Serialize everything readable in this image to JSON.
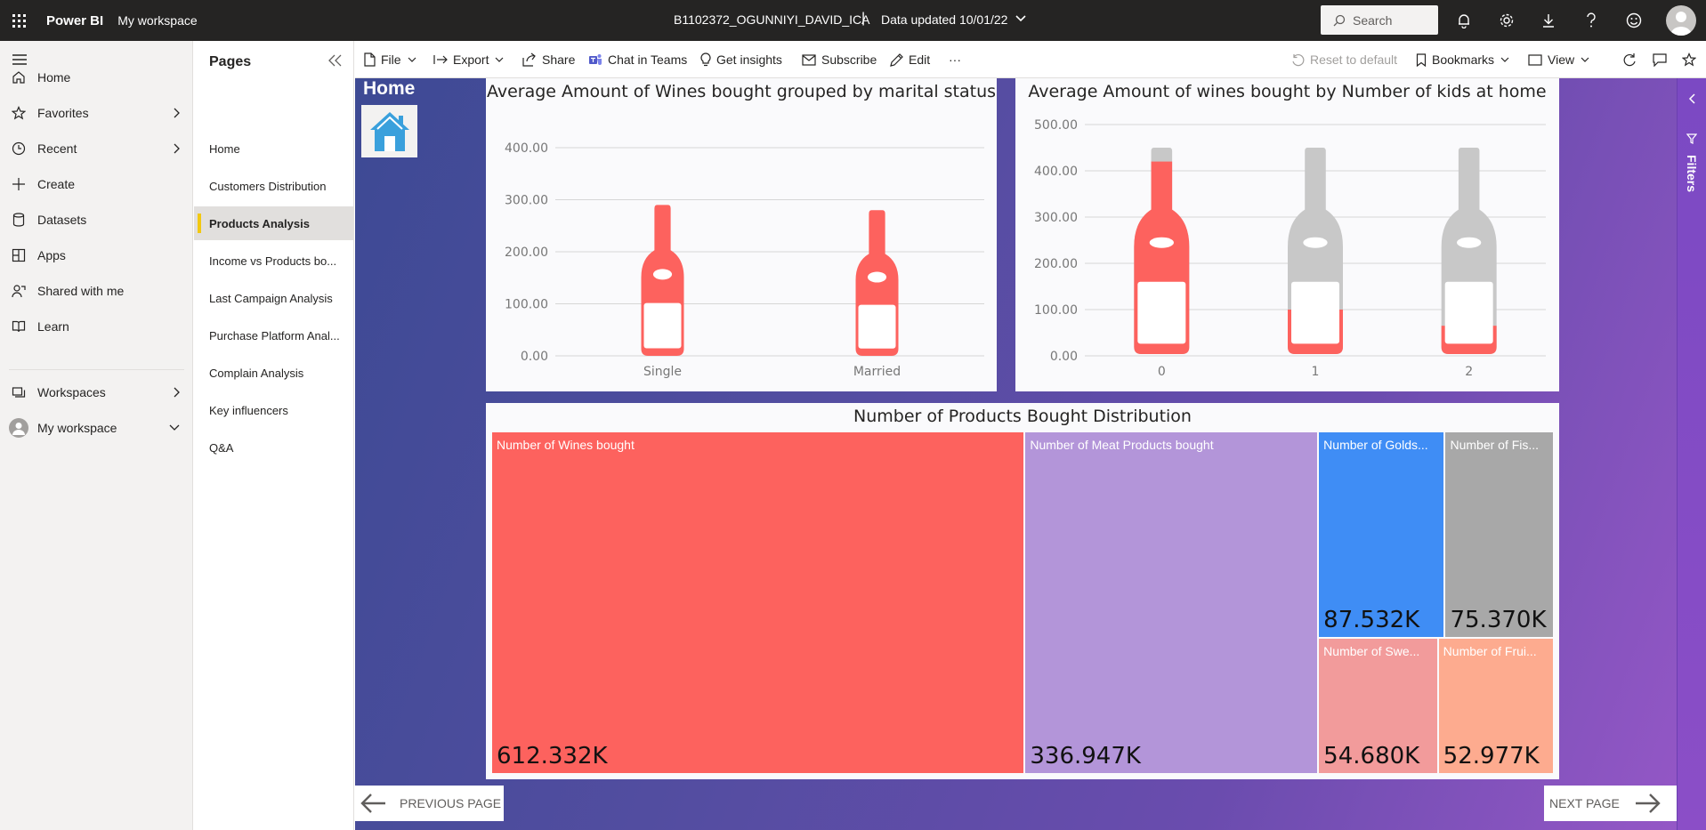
{
  "topbar": {
    "brand": "Power BI",
    "workspace": "My workspace",
    "report_title": "B1102372_OGUNNIYI_DAVID_ICA",
    "separator": "|",
    "data_updated": "Data updated 10/01/22",
    "search_placeholder": "Search"
  },
  "leftnav": {
    "items": [
      {
        "label": "Home",
        "icon": "home-icon"
      },
      {
        "label": "Favorites",
        "icon": "star-icon"
      },
      {
        "label": "Recent",
        "icon": "clock-icon"
      },
      {
        "label": "Create",
        "icon": "plus-icon"
      },
      {
        "label": "Datasets",
        "icon": "database-icon"
      },
      {
        "label": "Apps",
        "icon": "apps-icon"
      },
      {
        "label": "Shared with me",
        "icon": "shared-icon"
      },
      {
        "label": "Learn",
        "icon": "book-icon"
      },
      {
        "label": "Workspaces",
        "icon": "workspaces-icon"
      },
      {
        "label": "My workspace",
        "icon": "avatar-icon"
      }
    ]
  },
  "pages": {
    "title": "Pages",
    "items": [
      "Home",
      "Customers Distribution",
      "Products Analysis",
      "Income vs Products bo...",
      "Last Campaign Analysis",
      "Purchase Platform Anal...",
      "Complain Analysis",
      "Key influencers",
      "Q&A"
    ],
    "active": "Products Analysis"
  },
  "toolbar": {
    "file": "File",
    "export": "Export",
    "share": "Share",
    "chat": "Chat in Teams",
    "insights": "Get insights",
    "subscribe": "Subscribe",
    "edit": "Edit",
    "more": "···",
    "reset": "Reset to default",
    "bookmarks": "Bookmarks",
    "view": "View"
  },
  "canvas": {
    "home_label": "Home",
    "prev_page": "PREVIOUS PAGE",
    "next_page": "NEXT PAGE",
    "filters": "Filters"
  },
  "chart_data": [
    {
      "type": "bar",
      "title": "Average Amount of Wines bought grouped by marital status",
      "categories": [
        "Single",
        "Married"
      ],
      "values": [
        290,
        280
      ],
      "ylim": [
        0,
        400
      ],
      "yticks": [
        "0.00",
        "100.00",
        "200.00",
        "300.00",
        "400.00"
      ],
      "grid": true,
      "color": "#fd625e"
    },
    {
      "type": "bar",
      "title": "Average Amount of wines bought by Number of kids at home",
      "categories": [
        "0",
        "1",
        "2"
      ],
      "values": [
        420,
        100,
        65
      ],
      "ylim": [
        0,
        500
      ],
      "yticks": [
        "0.00",
        "100.00",
        "200.00",
        "300.00",
        "400.00",
        "500.00"
      ],
      "grid": true,
      "color": "#fd625e",
      "empty_color": "#c8c8c8"
    },
    {
      "type": "treemap",
      "title": "Number of Products Bought Distribution",
      "items": [
        {
          "label": "Number of Wines bought",
          "value": 612332,
          "display": "612.332K",
          "color": "#fd625e"
        },
        {
          "label": "Number of Meat Products bought",
          "value": 336947,
          "display": "336.947K",
          "color": "#b395d9"
        },
        {
          "label": "Number of Golds...",
          "value": 87532,
          "display": "87.532K",
          "color": "#3f8df5"
        },
        {
          "label": "Number of Fis...",
          "value": 75370,
          "display": "75.370K",
          "color": "#a8a8a8"
        },
        {
          "label": "Number of Swe...",
          "value": 54680,
          "display": "54.680K",
          "color": "#f29b9b"
        },
        {
          "label": "Number of Frui...",
          "value": 52977,
          "display": "52.977K",
          "color": "#fdab8f"
        }
      ]
    }
  ]
}
